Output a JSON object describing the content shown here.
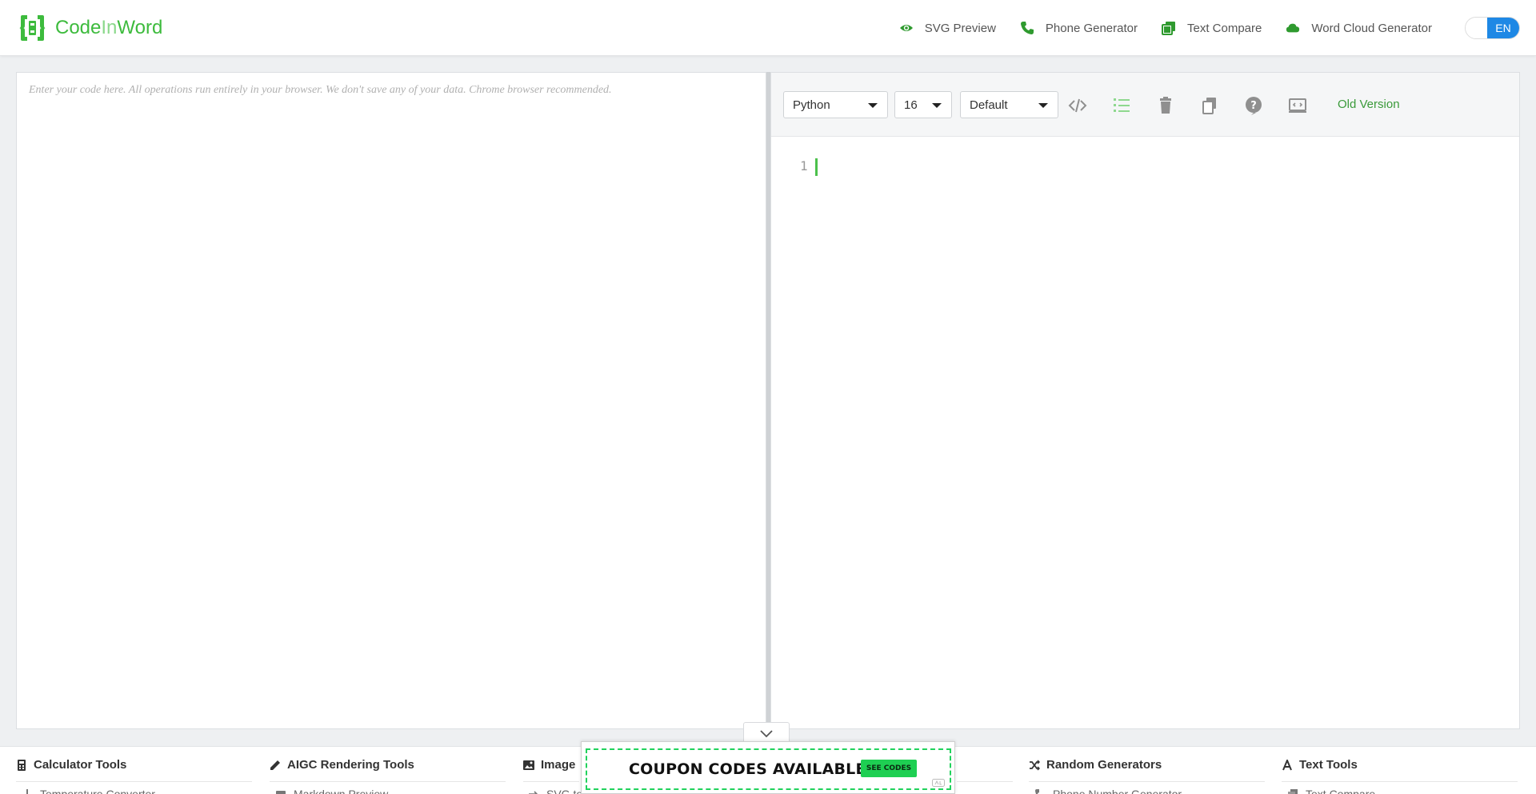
{
  "header": {
    "logo": {
      "code": "Code",
      "in": "In",
      "word": "Word"
    },
    "nav": [
      {
        "label": "SVG Preview",
        "icon": "eye-icon"
      },
      {
        "label": "Phone Generator",
        "icon": "phone-icon"
      },
      {
        "label": "Text Compare",
        "icon": "copy-icon"
      },
      {
        "label": "Word Cloud Generator",
        "icon": "cloud-icon"
      }
    ],
    "lang": {
      "other": "",
      "active": "EN"
    }
  },
  "input_panel": {
    "placeholder": "Enter your code here. All operations run entirely in your browser. We don't save any of your data. Chrome browser recommended."
  },
  "toolbar": {
    "language": "Python",
    "font_size": "16",
    "theme": "Default",
    "old_version": "Old Version",
    "icons": [
      "code-icon",
      "line-numbers-icon",
      "trash-icon",
      "copy-icon",
      "help-icon",
      "screenshot-icon"
    ]
  },
  "editor": {
    "line_number": "1"
  },
  "categories": [
    {
      "title": "Calculator Tools",
      "icon": "calculator-icon",
      "first_item": "Temperature Converter"
    },
    {
      "title": "AIGC Rendering Tools",
      "icon": "pencil-icon",
      "first_item": "Markdown Preview"
    },
    {
      "title": "Image",
      "icon": "image-icon",
      "first_item": "SVG to"
    },
    {
      "title": "Random Generators",
      "icon": "shuffle-icon",
      "first_item": "Phone Number Generator"
    },
    {
      "title": "Text Tools",
      "icon": "font-icon",
      "first_item": "Text Compare"
    }
  ],
  "ad": {
    "text": "COUPON CODES AVAILABLE",
    "button": "SEE CODES"
  },
  "colors": {
    "brand_green": "#3dbb3d",
    "accent_blue": "#1e88e5"
  }
}
